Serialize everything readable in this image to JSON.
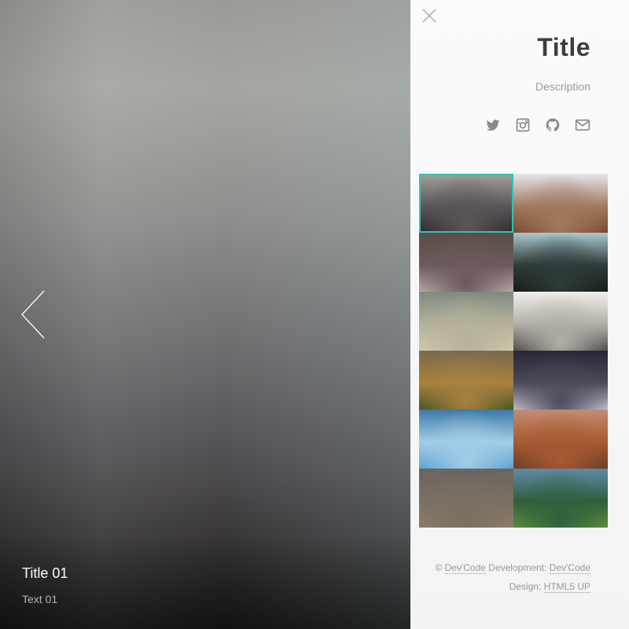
{
  "viewer": {
    "caption_title": "Title 01",
    "caption_text": "Text 01",
    "prev_icon": "chevron-left-icon"
  },
  "panel": {
    "close_icon": "close-icon",
    "title": "Title",
    "description": "Description",
    "social_icons": [
      "twitter-icon",
      "instagram-icon",
      "github-icon",
      "envelope-icon"
    ],
    "accent_color": "#2ec4b6",
    "thumbnails": [
      {
        "colors": [
          "#a4a09c",
          "#5b5659",
          "#2b2a30"
        ],
        "active": true
      },
      {
        "colors": [
          "#e6e6ea",
          "#a07a60",
          "#7b4a2e"
        ],
        "active": false
      },
      {
        "colors": [
          "#5a4d48",
          "#6c5a5a",
          "#b7a6a5"
        ],
        "active": false
      },
      {
        "colors": [
          "#a9c8cf",
          "#2f3c3a",
          "#161b19"
        ],
        "active": false
      },
      {
        "colors": [
          "#7d8a7f",
          "#b5b29a",
          "#cfc8aa"
        ],
        "active": false
      },
      {
        "colors": [
          "#f1efeb",
          "#b3afa8",
          "#524d49"
        ],
        "active": false
      },
      {
        "colors": [
          "#7a6a4e",
          "#a8813e",
          "#455628"
        ],
        "active": false
      },
      {
        "colors": [
          "#282737",
          "#4d4a5a",
          "#bdbcca"
        ],
        "active": false
      },
      {
        "colors": [
          "#3d79a6",
          "#a3cde6",
          "#5ea3cf"
        ],
        "active": false
      },
      {
        "colors": [
          "#c58c72",
          "#a65a32",
          "#6b3e24"
        ],
        "active": false
      },
      {
        "colors": [
          "#6a6560",
          "#7a6f62",
          "#8c7c6a"
        ],
        "active": false
      },
      {
        "colors": [
          "#5f8aa8",
          "#315f3d",
          "#5b8a3c"
        ],
        "active": false
      }
    ]
  },
  "footer": {
    "copyright": "© ",
    "brand": "Dev'Code",
    "dev_label": " Development: ",
    "dev_link": "Dev'Code",
    "design_label": "Design: ",
    "design_link": "HTML5 UP"
  }
}
